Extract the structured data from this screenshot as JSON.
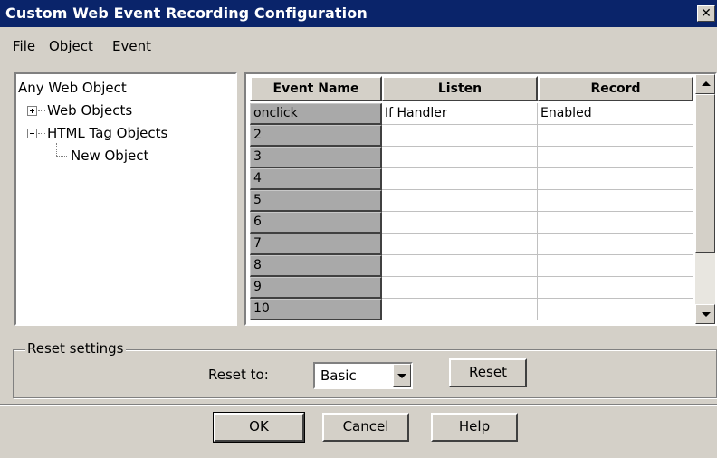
{
  "window": {
    "title": "Custom Web Event Recording Configuration",
    "close_glyph": "✕"
  },
  "menu": {
    "items": [
      {
        "label": "File"
      },
      {
        "label": "Object"
      },
      {
        "label": "Event"
      }
    ]
  },
  "tree": {
    "root": "Any Web Object",
    "nodes": [
      {
        "label": "Web Objects",
        "state": "collapsed"
      },
      {
        "label": "HTML Tag Objects",
        "state": "expanded"
      },
      {
        "label": "New Object",
        "state": "leaf"
      }
    ]
  },
  "grid": {
    "columns": [
      "Event Name",
      "Listen",
      "Record"
    ],
    "rows": [
      {
        "name": "onclick",
        "listen": "If Handler",
        "record": "Enabled"
      },
      {
        "name": "2",
        "listen": "",
        "record": ""
      },
      {
        "name": "3",
        "listen": "",
        "record": ""
      },
      {
        "name": "4",
        "listen": "",
        "record": ""
      },
      {
        "name": "5",
        "listen": "",
        "record": ""
      },
      {
        "name": "6",
        "listen": "",
        "record": ""
      },
      {
        "name": "7",
        "listen": "",
        "record": ""
      },
      {
        "name": "8",
        "listen": "",
        "record": ""
      },
      {
        "name": "9",
        "listen": "",
        "record": ""
      },
      {
        "name": "10",
        "listen": "",
        "record": ""
      }
    ]
  },
  "reset": {
    "group_label": "Reset settings",
    "reset_to_label": "Reset to:",
    "selected": "Basic",
    "reset_button": "Reset"
  },
  "buttons": {
    "ok": "OK",
    "cancel": "Cancel",
    "help": "Help"
  },
  "colors": {
    "titlebar": "#0a246a",
    "face": "#d4d0c8",
    "rowheader": "#a9a9a9"
  }
}
